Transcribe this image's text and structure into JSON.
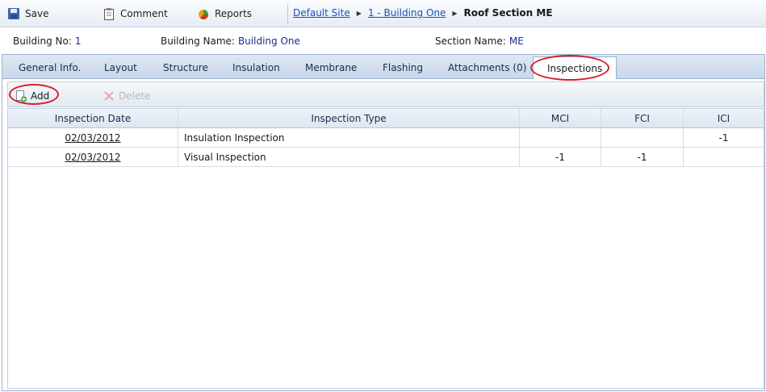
{
  "toolbar": {
    "save_label": "Save",
    "comment_label": "Comment",
    "reports_label": "Reports"
  },
  "breadcrumb": {
    "site": "Default Site",
    "building": "1 - Building One",
    "current": "Roof Section ME"
  },
  "info": {
    "building_no_label": "Building No:",
    "building_no": "1",
    "building_name_label": "Building Name:",
    "building_name": "Building One",
    "section_name_label": "Section Name:",
    "section_name": "ME"
  },
  "tabs": [
    {
      "label": "General Info."
    },
    {
      "label": "Layout"
    },
    {
      "label": "Structure"
    },
    {
      "label": "Insulation"
    },
    {
      "label": "Membrane"
    },
    {
      "label": "Flashing"
    },
    {
      "label": "Attachments (0)"
    },
    {
      "label": "Inspections",
      "active": true
    }
  ],
  "actions": {
    "add_label": "Add",
    "delete_label": "Delete"
  },
  "grid": {
    "columns": [
      "Inspection Date",
      "Inspection Type",
      "MCI",
      "FCI",
      "ICI"
    ],
    "rows": [
      {
        "date": "02/03/2012",
        "type": "Insulation Inspection",
        "mci": "",
        "fci": "",
        "ici": "-1"
      },
      {
        "date": "02/03/2012",
        "type": "Visual Inspection",
        "mci": "-1",
        "fci": "-1",
        "ici": ""
      }
    ]
  },
  "colors": {
    "highlight": "#d61f2a",
    "link": "#1a52b8",
    "value": "#1a2c8a"
  }
}
